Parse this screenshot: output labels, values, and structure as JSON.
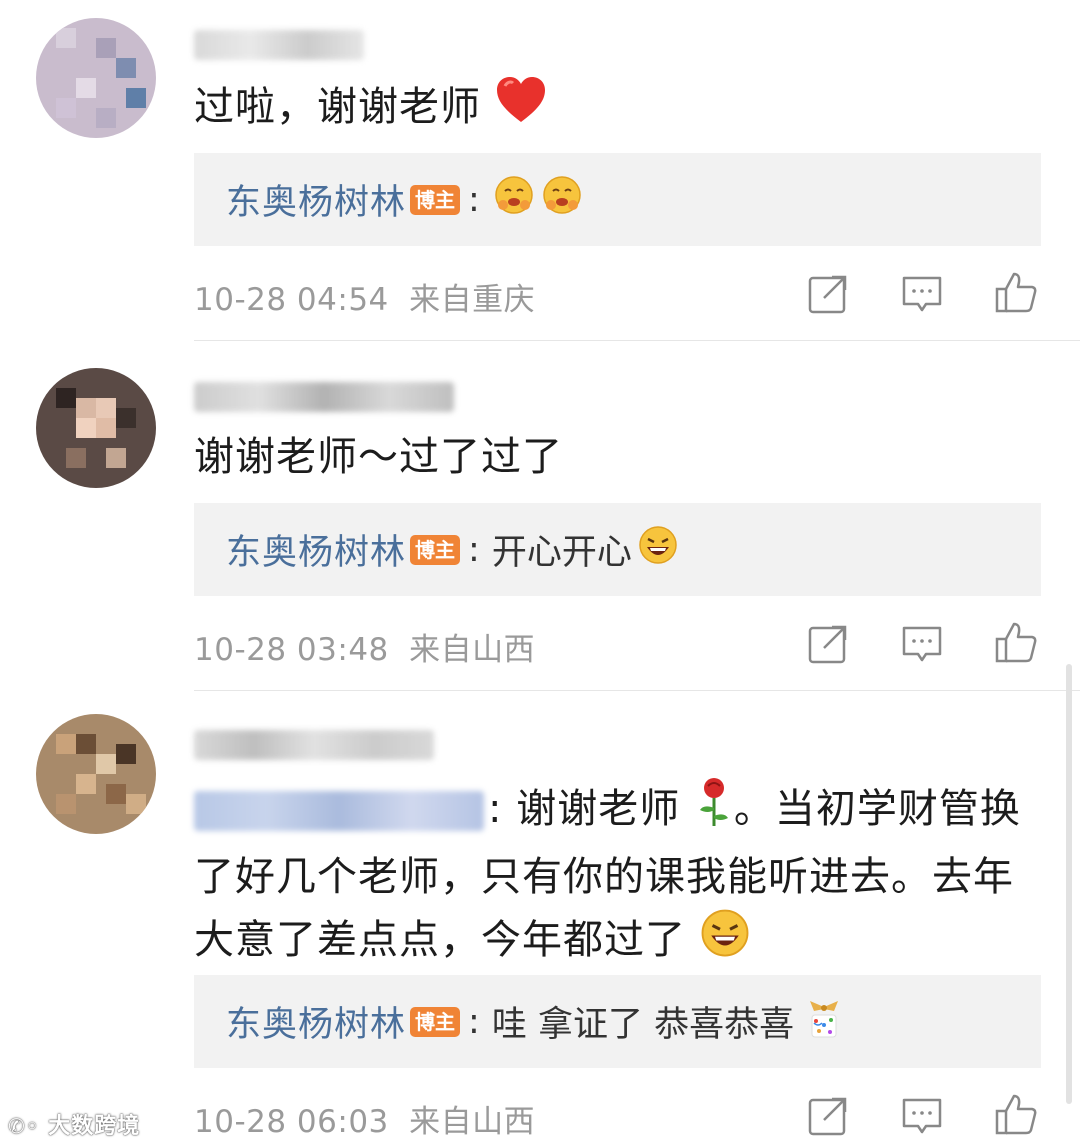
{
  "comments": [
    {
      "text": "过啦，谢谢老师",
      "reply": {
        "author": "东奥杨树林",
        "badge": "博主",
        "sep": ":",
        "text": ""
      },
      "time": "10-28 04:54",
      "location": "来自重庆"
    },
    {
      "text": "谢谢老师～过了过了",
      "reply": {
        "author": "东奥杨树林",
        "badge": "博主",
        "sep": ":",
        "text": "开心开心"
      },
      "time": "10-28 03:48",
      "location": "来自山西"
    },
    {
      "text_line1": ": 谢谢老师",
      "text_line1b": "。当初学财管换",
      "text_line2": "了好几个老师，只有你的课我能听进去。去年",
      "text_line3": "大意了差点点，今年都过了",
      "reply": {
        "author": "东奥杨树林",
        "badge": "博主",
        "sep": ":",
        "text": "哇 拿证了 恭喜恭喜"
      },
      "time": "10-28 06:03",
      "location": "来自山西"
    }
  ],
  "icons": {
    "share": "share-icon",
    "comment": "comment-icon",
    "like": "like-icon",
    "heart": "red-heart-emoji",
    "hug": "hug-emoji",
    "laugh": "laughing-emoji",
    "rose": "rose-emoji",
    "confetti": "confetti-emoji"
  },
  "watermark": "大数跨境",
  "colors": {
    "author": "#4a6f9b",
    "badge": "#f08436",
    "meta": "#9a9a9a",
    "reply_bg": "#f2f2f2"
  }
}
